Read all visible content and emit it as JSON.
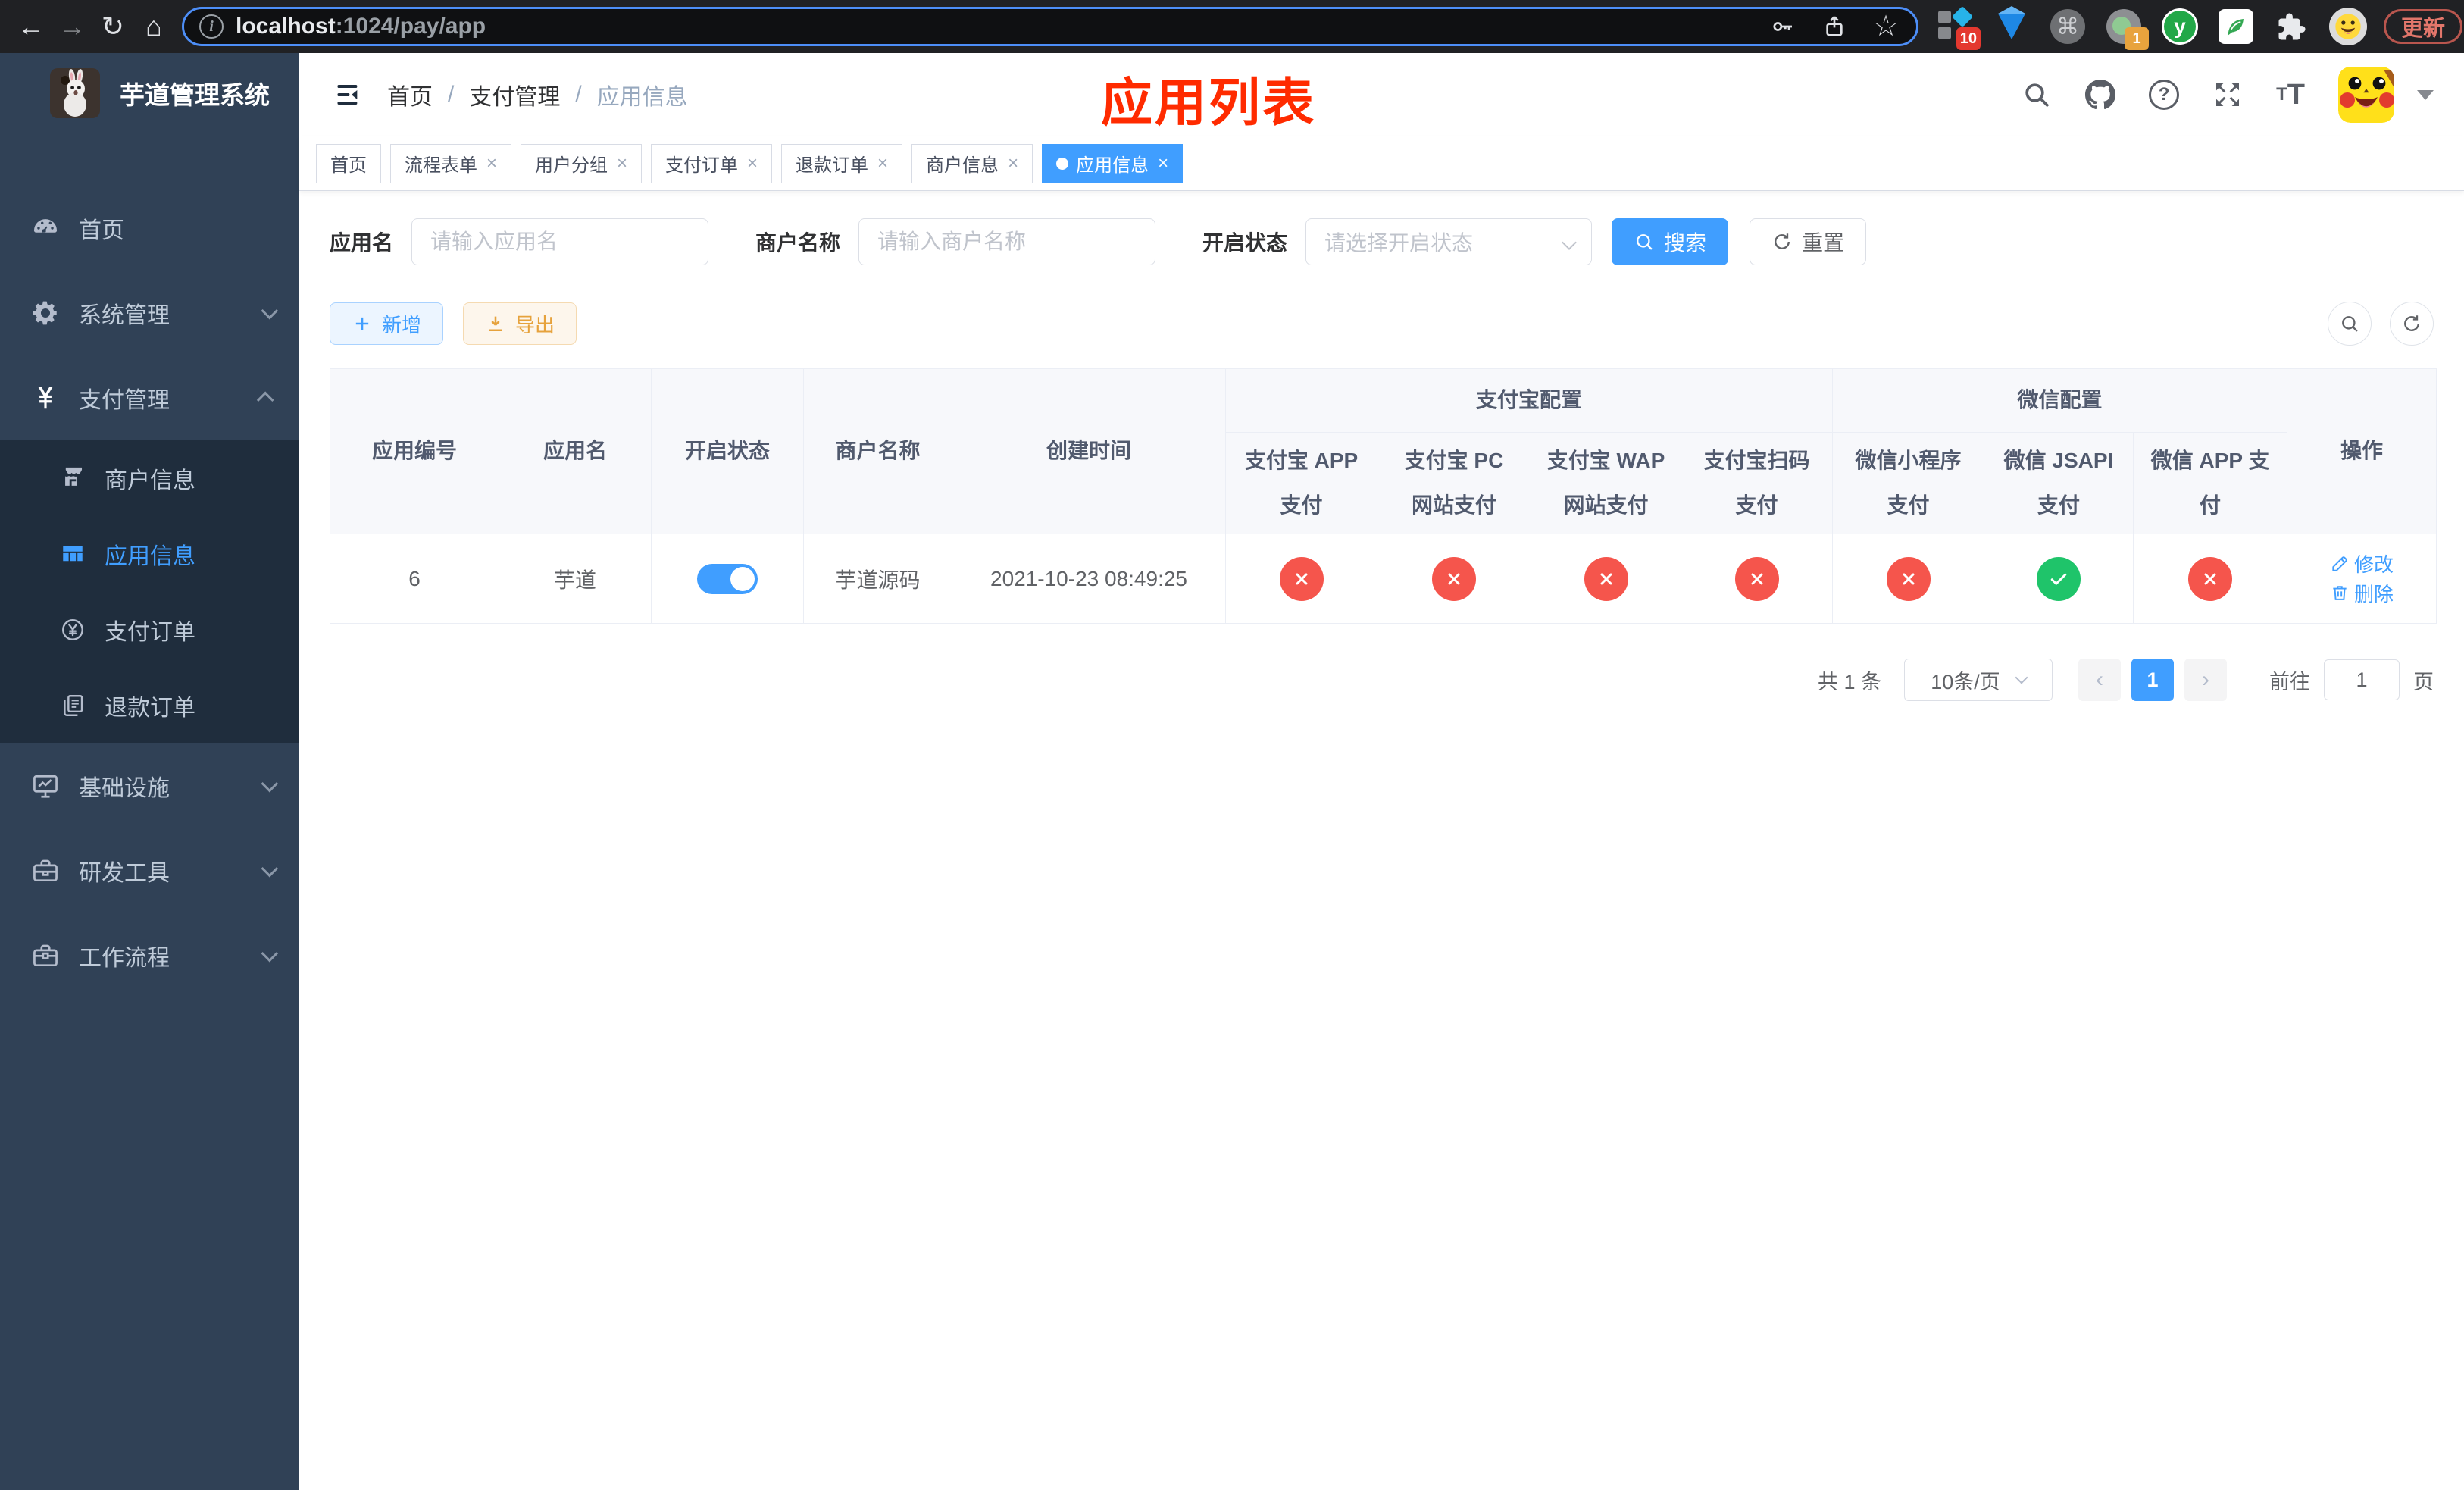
{
  "browser": {
    "url_host": "localhost",
    "url_path": ":1024/pay/app",
    "update_label": "更新",
    "badge_ten": "10",
    "badge_one": "1",
    "ext_y_letter": "y",
    "glyphs": {
      "back": "←",
      "forward": "→",
      "reload": "↻",
      "home": "⌂",
      "info": "i",
      "star": "☆",
      "command": "⌘",
      "dots": "⋮"
    }
  },
  "sidebar": {
    "title": "芋道管理系统",
    "menu": [
      {
        "key": "home",
        "label": "首页",
        "icon": "dashboard"
      },
      {
        "key": "system",
        "label": "系统管理",
        "icon": "gear",
        "chevron": "down"
      },
      {
        "key": "payment",
        "label": "支付管理",
        "icon": "yen",
        "chevron": "up",
        "children": [
          {
            "key": "merchant-info",
            "label": "商户信息",
            "icon": "store"
          },
          {
            "key": "app-info",
            "label": "应用信息",
            "icon": "grid",
            "active": true
          },
          {
            "key": "pay-order",
            "label": "支付订单",
            "icon": "yen-circle"
          },
          {
            "key": "refund-order",
            "label": "退款订单",
            "icon": "docs"
          }
        ]
      },
      {
        "key": "infrastructure",
        "label": "基础设施",
        "icon": "monitor",
        "chevron": "down"
      },
      {
        "key": "dev-tools",
        "label": "研发工具",
        "icon": "toolbox",
        "chevron": "down"
      },
      {
        "key": "workflow",
        "label": "工作流程",
        "icon": "toolbox2",
        "chevron": "down"
      }
    ]
  },
  "header": {
    "breadcrumb": [
      "首页",
      "支付管理",
      "应用信息"
    ],
    "annotation": "应用列表",
    "question_glyph": "?",
    "font_small": "T",
    "font_big": "T"
  },
  "tabs": [
    {
      "label": "首页",
      "closable": false,
      "active": false
    },
    {
      "label": "流程表单",
      "closable": true,
      "active": false
    },
    {
      "label": "用户分组",
      "closable": true,
      "active": false
    },
    {
      "label": "支付订单",
      "closable": true,
      "active": false
    },
    {
      "label": "退款订单",
      "closable": true,
      "active": false
    },
    {
      "label": "商户信息",
      "closable": true,
      "active": false
    },
    {
      "label": "应用信息",
      "closable": true,
      "active": true
    }
  ],
  "filters": {
    "app_name_label": "应用名",
    "app_name_placeholder": "请输入应用名",
    "merchant_label": "商户名称",
    "merchant_placeholder": "请输入商户名称",
    "status_label": "开启状态",
    "status_placeholder": "请选择开启状态",
    "search_button": "搜索",
    "reset_button": "重置"
  },
  "toolbar": {
    "add_button": "新增",
    "export_button": "导出"
  },
  "table": {
    "groups": {
      "alipay": "支付宝配置",
      "wechat": "微信配置"
    },
    "columns": [
      "应用编号",
      "应用名",
      "开启状态",
      "商户名称",
      "创建时间",
      "支付宝 APP 支付",
      "支付宝 PC 网站支付",
      "支付宝 WAP 网站支付",
      "支付宝扫码支付",
      "微信小程序支付",
      "微信 JSAPI 支付",
      "微信 APP 支付",
      "操作"
    ],
    "rows": [
      {
        "id": "6",
        "name": "芋道",
        "enabled": true,
        "merchant": "芋道源码",
        "created": "2021-10-23 08:49:25",
        "statuses": [
          "no",
          "no",
          "no",
          "no",
          "no",
          "yes",
          "no"
        ],
        "edit_label": "修改",
        "delete_label": "删除"
      }
    ]
  },
  "pagination": {
    "total": "共 1 条",
    "page_size": "10条/页",
    "current_page": "1",
    "prev_glyph": "‹",
    "next_glyph": "›",
    "goto_label": "前往",
    "goto_value": "1",
    "page_label": "页"
  },
  "colors": {
    "accent": "#409EFF",
    "danger": "#f5554c",
    "success": "#1fc46a",
    "warning": "#e6a23c",
    "annotation_red": "#ff2b00"
  }
}
